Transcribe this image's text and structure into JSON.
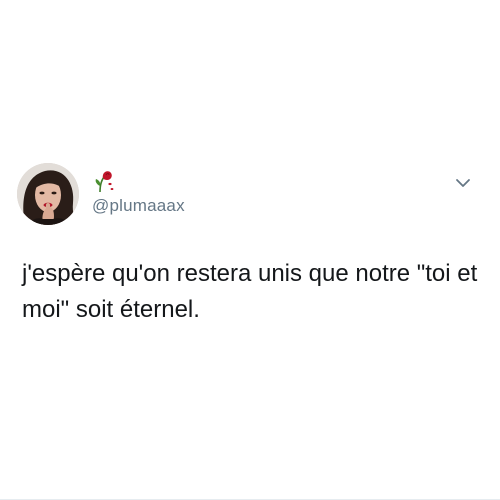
{
  "tweet": {
    "display_name_icon": "wilted-rose-emoji",
    "handle": "@plumaaax",
    "text": "j'espère qu'on restera unis que notre \"toi et moi\" soit éternel.",
    "menu_icon": "chevron-down-icon"
  },
  "colors": {
    "text": "#14171a",
    "handle": "#657786",
    "rose": "#c0152a",
    "chevron": "#657786"
  }
}
